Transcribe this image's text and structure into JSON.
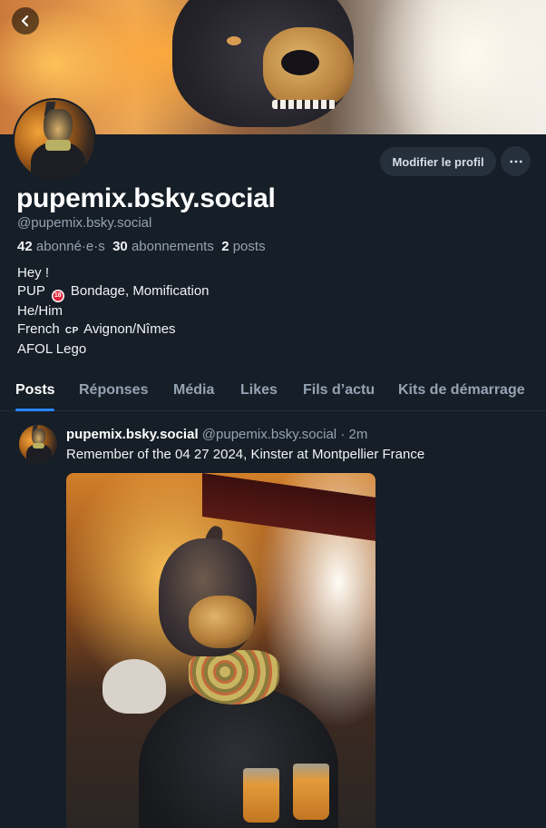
{
  "profile": {
    "display_name": "pupemix.bsky.social",
    "handle": "@pupemix.bsky.social",
    "followers_count": "42",
    "followers_label": "abonné·e·s",
    "following_count": "30",
    "following_label": "abonnements",
    "posts_count": "2",
    "posts_label": "posts",
    "bio": {
      "line1": "Hey !",
      "line2_pre": "PUP",
      "line2_emoji": "18",
      "line2_post": "Bondage, Momification",
      "line3": "He/Him",
      "line4_pre": "French",
      "line4_flag": "CP",
      "line4_post": "Avignon/Nîmes",
      "line5": "AFOL Lego"
    }
  },
  "actions": {
    "edit_label": "Modifier le profil"
  },
  "tabs": [
    {
      "label": "Posts",
      "active": true
    },
    {
      "label": "Réponses"
    },
    {
      "label": "Média"
    },
    {
      "label": "Likes"
    },
    {
      "label": "Fils d’actu"
    },
    {
      "label": "Kits de démarrage"
    }
  ],
  "post": {
    "author_name": "pupemix.bsky.social",
    "author_handle": "@pupemix.bsky.social",
    "separator": "·",
    "time": "2m",
    "text": "Remember of the 04 27 2024, Kinster at Montpellier France"
  },
  "icons": {
    "back": "chevron-left-icon",
    "more": "ellipsis-icon"
  },
  "colors": {
    "background": "#161e27",
    "accent": "#2a85ff",
    "muted_text": "#95a3b3",
    "button_bg": "#26303c"
  }
}
